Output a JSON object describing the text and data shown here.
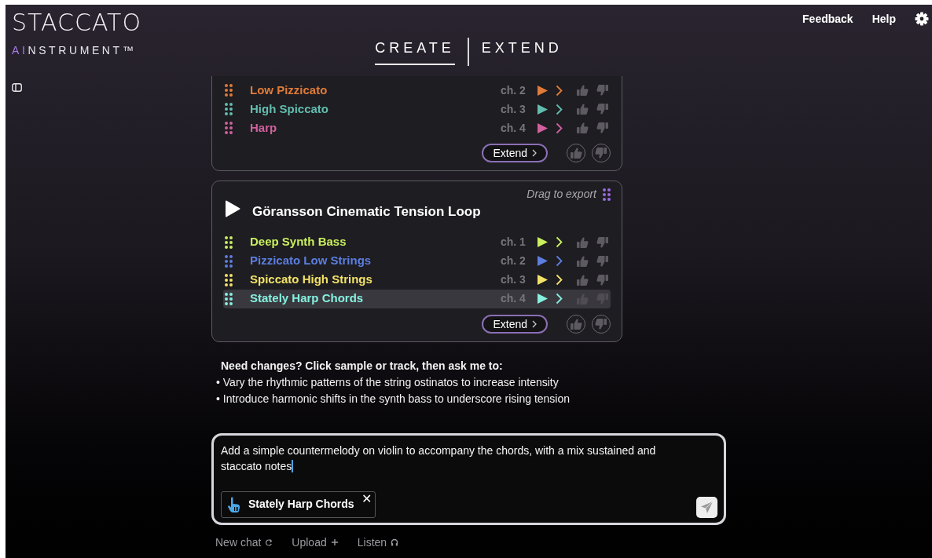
{
  "header": {
    "logo": {
      "wordmark": "STACCATO",
      "accent": "AI",
      "tagline": "NSTRUMENT™"
    },
    "tabs": [
      {
        "label": "CREATE",
        "selected": true
      },
      {
        "label": "EXTEND",
        "selected": false
      }
    ],
    "links": [
      "Feedback",
      "Help"
    ]
  },
  "samples": [
    {
      "tracks": [
        {
          "name": "Low Pizzicato",
          "channel": "ch. 2",
          "color": "#e07b39",
          "selected": false
        },
        {
          "name": "High Spiccato",
          "channel": "ch. 3",
          "color": "#62bdb0",
          "selected": false
        },
        {
          "name": "Harp",
          "channel": "ch. 4",
          "color": "#d0609e",
          "selected": false
        }
      ],
      "extend_label": "Extend"
    },
    {
      "title": "Göransson Cinematic Tension Loop",
      "drag_hint": "Drag to export",
      "tracks": [
        {
          "name": "Deep Synth Bass",
          "channel": "ch. 1",
          "color": "#c9ef5e",
          "selected": false
        },
        {
          "name": "Pizzicato Low Strings",
          "channel": "ch. 2",
          "color": "#5b7ee0",
          "selected": false
        },
        {
          "name": "Spiccato High Strings",
          "channel": "ch. 3",
          "color": "#f2e268",
          "selected": false
        },
        {
          "name": "Stately Harp Chords",
          "channel": "ch. 4",
          "color": "#86f0df",
          "selected": true
        }
      ],
      "extend_label": "Extend"
    }
  ],
  "suggestions": {
    "heading": "Need changes? Click sample or track, then ask me to:",
    "items": [
      "• Vary the rhythmic patterns of the string ostinatos to increase intensity",
      "• Introduce harmonic shifts in the synth bass to underscore rising tension"
    ]
  },
  "composer": {
    "value": "Add a simple countermelody on violin to accompany the chords, with a mix sustained and staccato notes",
    "attachment": "Stately Harp Chords",
    "remove_glyph": "✕"
  },
  "actions": [
    {
      "label": "New chat",
      "kind": "refresh"
    },
    {
      "label": "Upload",
      "kind": "plus"
    },
    {
      "label": "Listen",
      "kind": "headphones"
    }
  ]
}
